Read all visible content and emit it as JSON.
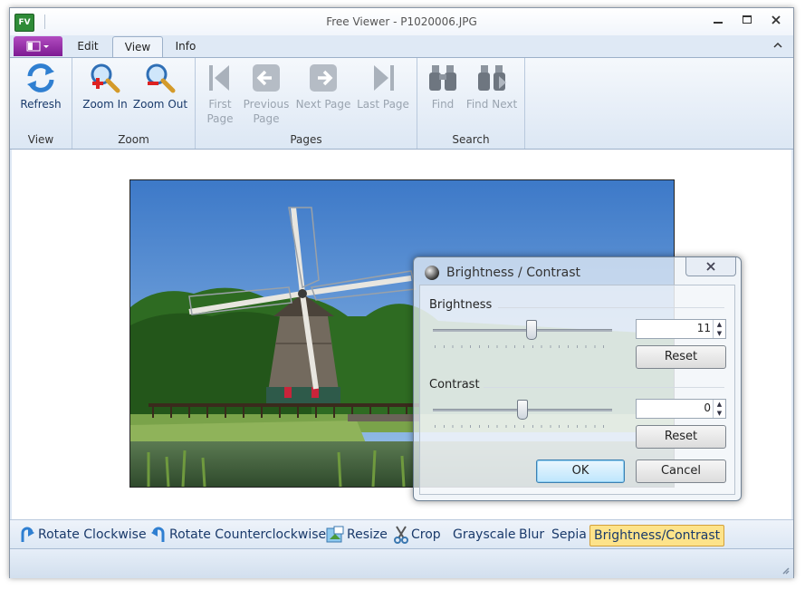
{
  "window": {
    "title": "Free Viewer - P1020006.JPG",
    "app_icon_text": "FV"
  },
  "tabs": [
    {
      "label": "Edit"
    },
    {
      "label": "View"
    },
    {
      "label": "Info"
    }
  ],
  "ribbon": {
    "groups": {
      "view": "View",
      "zoom": "Zoom",
      "pages": "Pages",
      "search": "Search"
    },
    "refresh": "Refresh",
    "zoom_in": "Zoom In",
    "zoom_out": "Zoom Out",
    "first_page_1": "First",
    "first_page_2": "Page",
    "previous_page_1": "Previous",
    "previous_page_2": "Page",
    "next_page": "Next Page",
    "last_page": "Last Page",
    "find": "Find",
    "find_next": "Find Next"
  },
  "effects": {
    "rotate_cw": "Rotate Clockwise",
    "rotate_ccw": "Rotate Counterclockwise",
    "resize": "Resize",
    "crop": "Crop",
    "grayscale": "Grayscale",
    "blur": "Blur",
    "sepia": "Sepia",
    "brightness_contrast": "Brightness/Contrast"
  },
  "dialog": {
    "title": "Brightness / Contrast",
    "brightness_label": "Brightness",
    "brightness_value": "11",
    "brightness_level": 0.55,
    "contrast_label": "Contrast",
    "contrast_value": "0",
    "contrast_level": 0.5,
    "reset_label": "Reset",
    "ok_label": "OK",
    "cancel_label": "Cancel"
  },
  "colors": {
    "accent": "#2e6fb9",
    "app_menu": "#8a2aa0",
    "active_effect": "#fde38a"
  }
}
